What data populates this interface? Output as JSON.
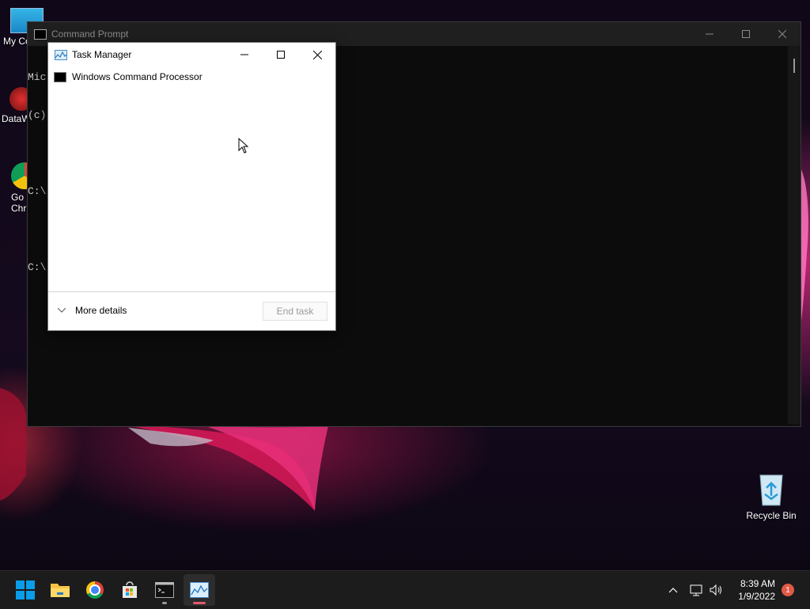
{
  "desktop": {
    "icons": [
      {
        "label": "My Co"
      },
      {
        "label": "DataW"
      },
      {
        "label": "Go\nChr"
      },
      {
        "label": "Recycle Bin"
      }
    ]
  },
  "cmd": {
    "title": "Command Prompt",
    "lines": [
      "Mic",
      "(c)",
      "",
      "C:\\",
      "",
      "C:\\"
    ]
  },
  "taskmanager": {
    "title": "Task Manager",
    "processes": [
      {
        "name": "Windows Command Processor",
        "icon": "cmd-icon"
      }
    ],
    "more_details": "More details",
    "end_task": "End task"
  },
  "taskbar": {
    "apps": [
      "windows-start",
      "file-explorer",
      "chrome",
      "microsoft-store",
      "command-prompt",
      "task-manager"
    ],
    "time": "8:39 AM",
    "date": "1/9/2022",
    "notifications": "1"
  },
  "colors": {
    "accent": "#0078d4",
    "indicator_active": "#e05a70",
    "indicator_open": "#9a9a9a"
  }
}
